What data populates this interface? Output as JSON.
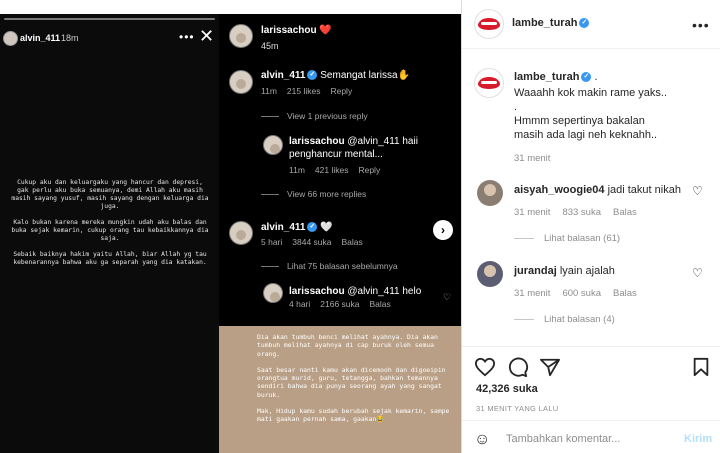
{
  "story": {
    "username": "alvin_411",
    "time": "18m",
    "paragraphs": [
      "Cukup aku dan keluargaku yang hancur dan depresi, gak perlu aku buka semuanya, demi Allah aku masih masih sayang yusuf, masih sayang dengan keluarga dia juga.",
      "Kalo bukan karena mereka mungkin udah aku balas dan buka sejak kemarin, cukup orang tau kebaikkannya dia saja.",
      "Sebaik baiknya hakim yaitu Allah, biar Allah yg tau kebenarannya bahwa aku ga separah yang dia katakan."
    ]
  },
  "comments_shot": {
    "header": {
      "username": "larissachou",
      "emoji": "❤️",
      "time": "45m"
    },
    "c1": {
      "username": "alvin_411",
      "text": "Semangat larissa✋",
      "time": "11m",
      "likes": "215 likes",
      "reply": "Reply",
      "view_link": "View 1 previous reply"
    },
    "c2": {
      "username": "larissachou",
      "text": "@alvin_411 haii penghancur mental...",
      "time": "11m",
      "likes": "421 likes",
      "reply": "Reply",
      "view_link": "View 66 more replies"
    },
    "c3": {
      "username": "alvin_411",
      "text": "🤍",
      "time": "5 hari",
      "likes": "3844 suka",
      "reply": "Balas",
      "view_link": "Lihat 75 balasan sebelumnya"
    },
    "c4": {
      "username": "larissachou",
      "text": "@alvin_411 helo",
      "time": "4 hari",
      "likes": "2166 suka",
      "reply": "Balas"
    }
  },
  "quote": {
    "paragraphs": [
      "Dia akan tumbuh benci melihat ayahnya. Dia akan tumbuh melihat ayahnya di cap buruk oleh semua orang.",
      "Saat besar nanti kamu akan dicemooh dan digoeipin orangtua murid, guru, tetangga, bahkan temannya sendiri bahwa dia punya seorang ayah yang sangat buruk.",
      "Mak, Hidup kamu sudah berubah sejak kemarin, sampe mati gaakan pernah sama, gaakan😂"
    ]
  },
  "post": {
    "account": "lambe_turah",
    "caption_author": "lambe_turah",
    "caption_lines": [
      "Waaahh kok makin rame yaks..",
      ".",
      "Hmmm sepertinya bakalan masih ada lagi neh keknahh.."
    ],
    "caption_time": "31 menit",
    "comments": [
      {
        "username": "aisyah_woogie04",
        "text": "jadi takut nikah",
        "time": "31 menit",
        "likes": "833 suka",
        "reply": "Balas",
        "replies": "Lihat balasan (61)"
      },
      {
        "username": "jurandaj",
        "text": "lyain ajalah",
        "time": "31 menit",
        "likes": "600 suka",
        "reply": "Balas",
        "replies": "Lihat balasan (4)"
      }
    ],
    "likes": "42,326 suka",
    "time_ago": "31 MENIT YANG LALU",
    "add_comment_placeholder": "Tambahkan komentar...",
    "post_button": "Kirim"
  },
  "colors": {
    "verified": "#3897f0",
    "brand_red": "#d81b2b",
    "post_btn": "#b2dffc"
  }
}
